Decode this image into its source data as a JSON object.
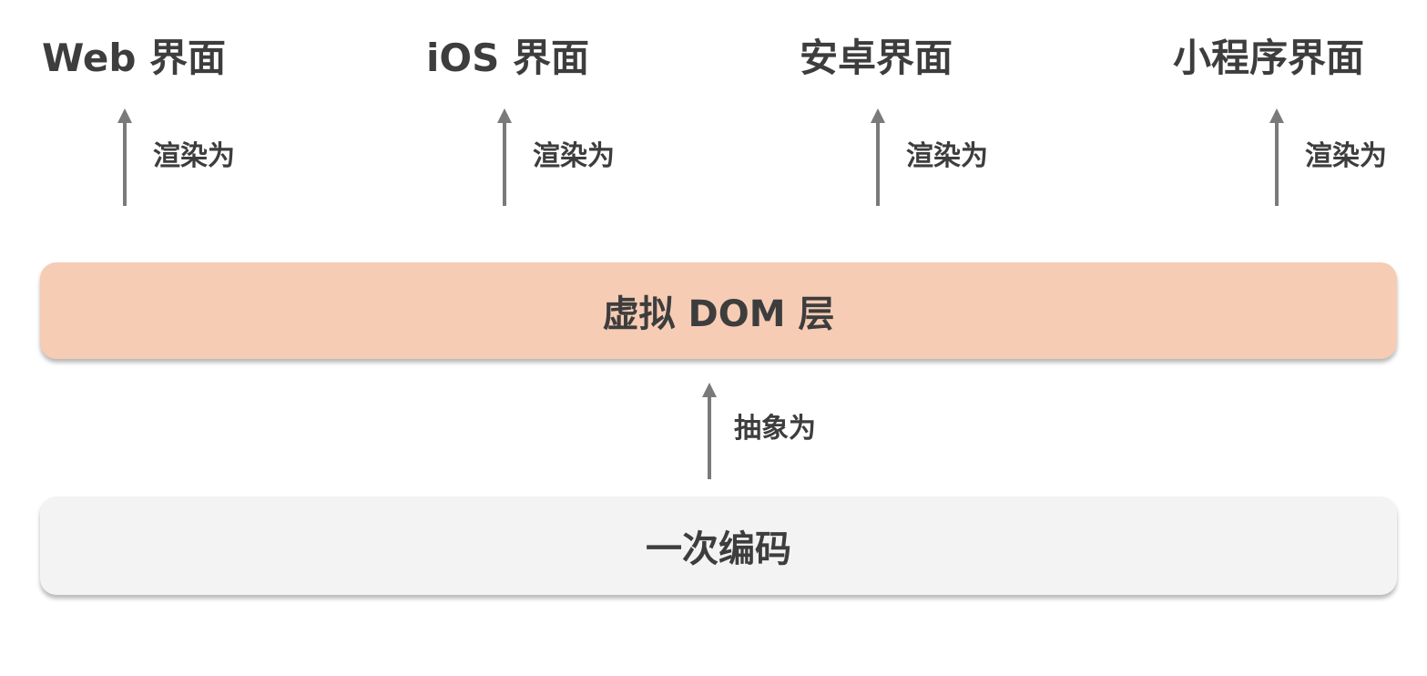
{
  "targets": [
    {
      "label": "Web 界面",
      "arrow_label": "渲染为"
    },
    {
      "label": "iOS 界面",
      "arrow_label": "渲染为"
    },
    {
      "label": "安卓界面",
      "arrow_label": "渲染为"
    },
    {
      "label": "小程序界面",
      "arrow_label": "渲染为"
    }
  ],
  "virtual_dom_layer": {
    "label": "虚拟 DOM 层"
  },
  "abstraction_arrow": {
    "label": "抽象为"
  },
  "source_layer": {
    "label": "一次编码"
  }
}
